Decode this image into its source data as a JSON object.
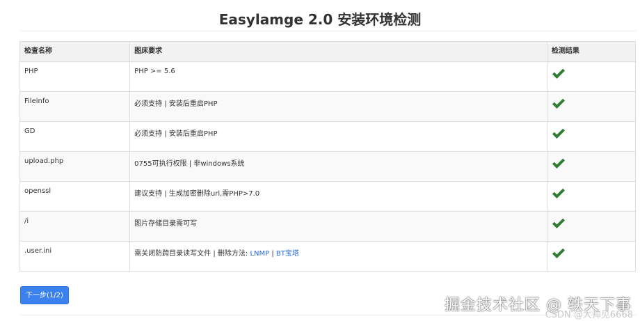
{
  "page": {
    "title": "Easylamge 2.0 安装环境检测"
  },
  "table": {
    "headers": {
      "name": "检查名称",
      "requirement": "图床要求",
      "result": "检测结果"
    },
    "rows": [
      {
        "name": "PHP",
        "requirement": "PHP >= 5.6",
        "result": "check-icon"
      },
      {
        "name": "Fileinfo",
        "requirement": "必须支持 | 安装后重启PHP",
        "result": "check-icon"
      },
      {
        "name": "GD",
        "requirement": "必须支持 | 安装后重启PHP",
        "result": "check-icon"
      },
      {
        "name": "upload.php",
        "requirement": "0755可执行权限 | 非windows系统",
        "result": "check-icon"
      },
      {
        "name": "openssl",
        "requirement": "建议支持 | 生成加密删除url,需PHP>7.0",
        "result": "check-icon"
      },
      {
        "name": "/i",
        "requirement": "图片存储目录需可写",
        "result": "check-icon"
      },
      {
        "name": ".user.ini",
        "requirement_prefix": "需关闭防跨目录读写文件 | 删除方法: ",
        "link_lnmp": "LNMP",
        "separator": " | ",
        "link_bt": "BT宝塔",
        "result": "check-icon"
      }
    ]
  },
  "actions": {
    "next_label": "下一步(1/2)"
  },
  "watermark": {
    "main": "掘金技术社区 @ 轶天下事",
    "sub": "CSDN @大帅见6668"
  },
  "colors": {
    "check_green": "#2e7d32",
    "button_blue": "#3b82f0",
    "link_blue": "#2a6bd6"
  }
}
